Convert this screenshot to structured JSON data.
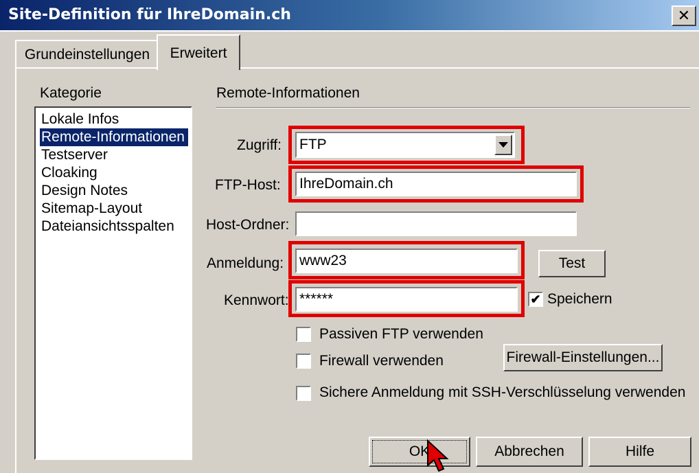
{
  "window": {
    "title": "Site-Definition für IhreDomain.ch",
    "close_glyph": "✕"
  },
  "tabs": [
    {
      "label": "Grundeinstellungen",
      "active": false
    },
    {
      "label": "Erweitert",
      "active": true
    }
  ],
  "category": {
    "label": "Kategorie",
    "items": [
      "Lokale Infos",
      "Remote-Informationen",
      "Testserver",
      "Cloaking",
      "Design Notes",
      "Sitemap-Layout",
      "Dateiansichtsspalten"
    ],
    "selected": "Remote-Informationen"
  },
  "section": {
    "title": "Remote-Informationen"
  },
  "form": {
    "zugriff": {
      "label": "Zugriff:",
      "value": "FTP"
    },
    "ftp_host": {
      "label": "FTP-Host:",
      "value": "IhreDomain.ch"
    },
    "host_ordner": {
      "label": "Host-Ordner:",
      "value": ""
    },
    "anmeldung": {
      "label": "Anmeldung:",
      "value": "www23"
    },
    "kennwort": {
      "label": "Kennwort:",
      "value": "******"
    },
    "speichern": {
      "label": "Speichern",
      "checked": true,
      "mark": "✔"
    },
    "test_button": "Test",
    "passive_ftp": {
      "label": "Passiven FTP verwenden",
      "checked": false
    },
    "firewall": {
      "label": "Firewall verwenden",
      "checked": false
    },
    "firewall_settings_button": "Firewall-Einstellungen...",
    "ssh": {
      "label": "Sichere Anmeldung mit SSH-Verschlüsselung verwenden",
      "checked": false
    }
  },
  "footer": {
    "ok": "OK",
    "cancel": "Abbrechen",
    "help": "Hilfe"
  },
  "highlight_color": "#e00000",
  "icons": {
    "cursor": "arrow-cursor-icon",
    "dropdown": "chevron-down-icon"
  }
}
